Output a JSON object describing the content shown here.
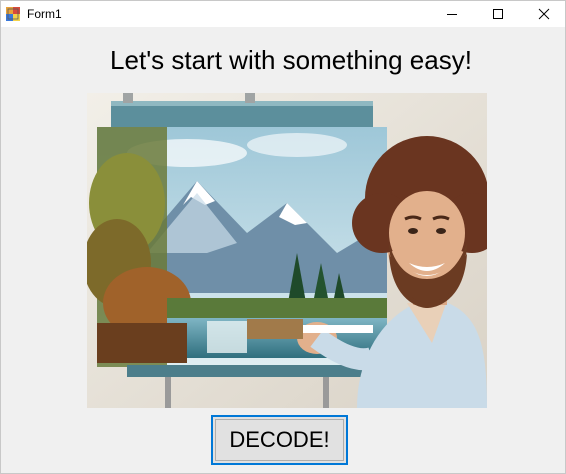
{
  "window": {
    "title": "Form1",
    "controls": {
      "minimize": "minimize-icon",
      "maximize": "maximize-icon",
      "close": "close-icon"
    }
  },
  "main": {
    "heading": "Let's start with something easy!",
    "image_subject": "painter-at-easel",
    "decode_button_label": "DECODE!"
  },
  "colors": {
    "window_bg": "#f0f0f0",
    "titlebar_bg": "#ffffff",
    "button_border_focus": "#0078d7",
    "button_bg": "#e1e1e1"
  }
}
